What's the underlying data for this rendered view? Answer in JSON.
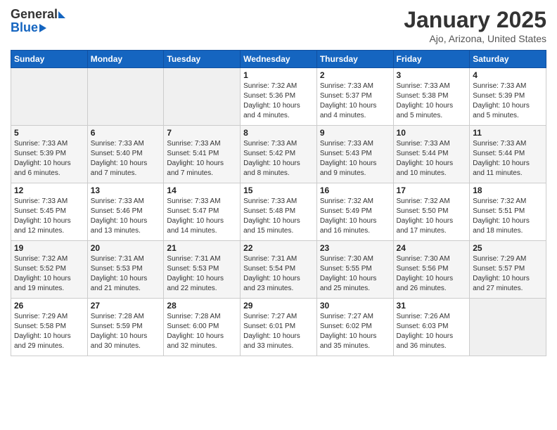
{
  "logo": {
    "general": "General",
    "blue": "Blue"
  },
  "title": "January 2025",
  "subtitle": "Ajo, Arizona, United States",
  "weekdays": [
    "Sunday",
    "Monday",
    "Tuesday",
    "Wednesday",
    "Thursday",
    "Friday",
    "Saturday"
  ],
  "weeks": [
    [
      {
        "day": "",
        "info": ""
      },
      {
        "day": "",
        "info": ""
      },
      {
        "day": "",
        "info": ""
      },
      {
        "day": "1",
        "info": "Sunrise: 7:32 AM\nSunset: 5:36 PM\nDaylight: 10 hours\nand 4 minutes."
      },
      {
        "day": "2",
        "info": "Sunrise: 7:33 AM\nSunset: 5:37 PM\nDaylight: 10 hours\nand 4 minutes."
      },
      {
        "day": "3",
        "info": "Sunrise: 7:33 AM\nSunset: 5:38 PM\nDaylight: 10 hours\nand 5 minutes."
      },
      {
        "day": "4",
        "info": "Sunrise: 7:33 AM\nSunset: 5:39 PM\nDaylight: 10 hours\nand 5 minutes."
      }
    ],
    [
      {
        "day": "5",
        "info": "Sunrise: 7:33 AM\nSunset: 5:39 PM\nDaylight: 10 hours\nand 6 minutes."
      },
      {
        "day": "6",
        "info": "Sunrise: 7:33 AM\nSunset: 5:40 PM\nDaylight: 10 hours\nand 7 minutes."
      },
      {
        "day": "7",
        "info": "Sunrise: 7:33 AM\nSunset: 5:41 PM\nDaylight: 10 hours\nand 7 minutes."
      },
      {
        "day": "8",
        "info": "Sunrise: 7:33 AM\nSunset: 5:42 PM\nDaylight: 10 hours\nand 8 minutes."
      },
      {
        "day": "9",
        "info": "Sunrise: 7:33 AM\nSunset: 5:43 PM\nDaylight: 10 hours\nand 9 minutes."
      },
      {
        "day": "10",
        "info": "Sunrise: 7:33 AM\nSunset: 5:44 PM\nDaylight: 10 hours\nand 10 minutes."
      },
      {
        "day": "11",
        "info": "Sunrise: 7:33 AM\nSunset: 5:44 PM\nDaylight: 10 hours\nand 11 minutes."
      }
    ],
    [
      {
        "day": "12",
        "info": "Sunrise: 7:33 AM\nSunset: 5:45 PM\nDaylight: 10 hours\nand 12 minutes."
      },
      {
        "day": "13",
        "info": "Sunrise: 7:33 AM\nSunset: 5:46 PM\nDaylight: 10 hours\nand 13 minutes."
      },
      {
        "day": "14",
        "info": "Sunrise: 7:33 AM\nSunset: 5:47 PM\nDaylight: 10 hours\nand 14 minutes."
      },
      {
        "day": "15",
        "info": "Sunrise: 7:33 AM\nSunset: 5:48 PM\nDaylight: 10 hours\nand 15 minutes."
      },
      {
        "day": "16",
        "info": "Sunrise: 7:32 AM\nSunset: 5:49 PM\nDaylight: 10 hours\nand 16 minutes."
      },
      {
        "day": "17",
        "info": "Sunrise: 7:32 AM\nSunset: 5:50 PM\nDaylight: 10 hours\nand 17 minutes."
      },
      {
        "day": "18",
        "info": "Sunrise: 7:32 AM\nSunset: 5:51 PM\nDaylight: 10 hours\nand 18 minutes."
      }
    ],
    [
      {
        "day": "19",
        "info": "Sunrise: 7:32 AM\nSunset: 5:52 PM\nDaylight: 10 hours\nand 19 minutes."
      },
      {
        "day": "20",
        "info": "Sunrise: 7:31 AM\nSunset: 5:53 PM\nDaylight: 10 hours\nand 21 minutes."
      },
      {
        "day": "21",
        "info": "Sunrise: 7:31 AM\nSunset: 5:53 PM\nDaylight: 10 hours\nand 22 minutes."
      },
      {
        "day": "22",
        "info": "Sunrise: 7:31 AM\nSunset: 5:54 PM\nDaylight: 10 hours\nand 23 minutes."
      },
      {
        "day": "23",
        "info": "Sunrise: 7:30 AM\nSunset: 5:55 PM\nDaylight: 10 hours\nand 25 minutes."
      },
      {
        "day": "24",
        "info": "Sunrise: 7:30 AM\nSunset: 5:56 PM\nDaylight: 10 hours\nand 26 minutes."
      },
      {
        "day": "25",
        "info": "Sunrise: 7:29 AM\nSunset: 5:57 PM\nDaylight: 10 hours\nand 27 minutes."
      }
    ],
    [
      {
        "day": "26",
        "info": "Sunrise: 7:29 AM\nSunset: 5:58 PM\nDaylight: 10 hours\nand 29 minutes."
      },
      {
        "day": "27",
        "info": "Sunrise: 7:28 AM\nSunset: 5:59 PM\nDaylight: 10 hours\nand 30 minutes."
      },
      {
        "day": "28",
        "info": "Sunrise: 7:28 AM\nSunset: 6:00 PM\nDaylight: 10 hours\nand 32 minutes."
      },
      {
        "day": "29",
        "info": "Sunrise: 7:27 AM\nSunset: 6:01 PM\nDaylight: 10 hours\nand 33 minutes."
      },
      {
        "day": "30",
        "info": "Sunrise: 7:27 AM\nSunset: 6:02 PM\nDaylight: 10 hours\nand 35 minutes."
      },
      {
        "day": "31",
        "info": "Sunrise: 7:26 AM\nSunset: 6:03 PM\nDaylight: 10 hours\nand 36 minutes."
      },
      {
        "day": "",
        "info": ""
      }
    ]
  ]
}
